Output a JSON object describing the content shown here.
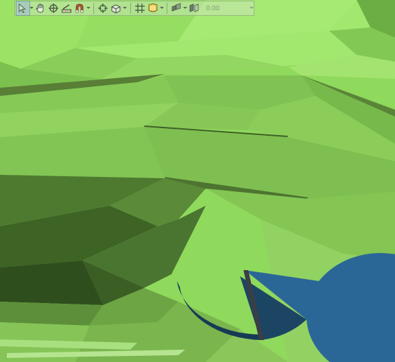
{
  "toolbar": {
    "tools": [
      {
        "name": "select-tool-icon",
        "active": true
      },
      {
        "name": "pan-hand-icon"
      },
      {
        "name": "orbit-target-icon"
      },
      {
        "name": "measure-ruler-icon"
      },
      {
        "name": "magnet-snap-icon"
      },
      {
        "name": "crosshair-pick-icon"
      },
      {
        "name": "cube-view-icon"
      },
      {
        "name": "grid-icon"
      },
      {
        "name": "layer-icon"
      },
      {
        "name": "vertical-scale-icon"
      },
      {
        "name": "opacity-slider-icon"
      }
    ],
    "offset_value": "0.00"
  },
  "scene": {
    "terrain_color": "#8fd95c",
    "object": "blue-disc-with-wedge-cutout",
    "object_color": "#2a6797",
    "marker_color": "#3a3e46"
  }
}
